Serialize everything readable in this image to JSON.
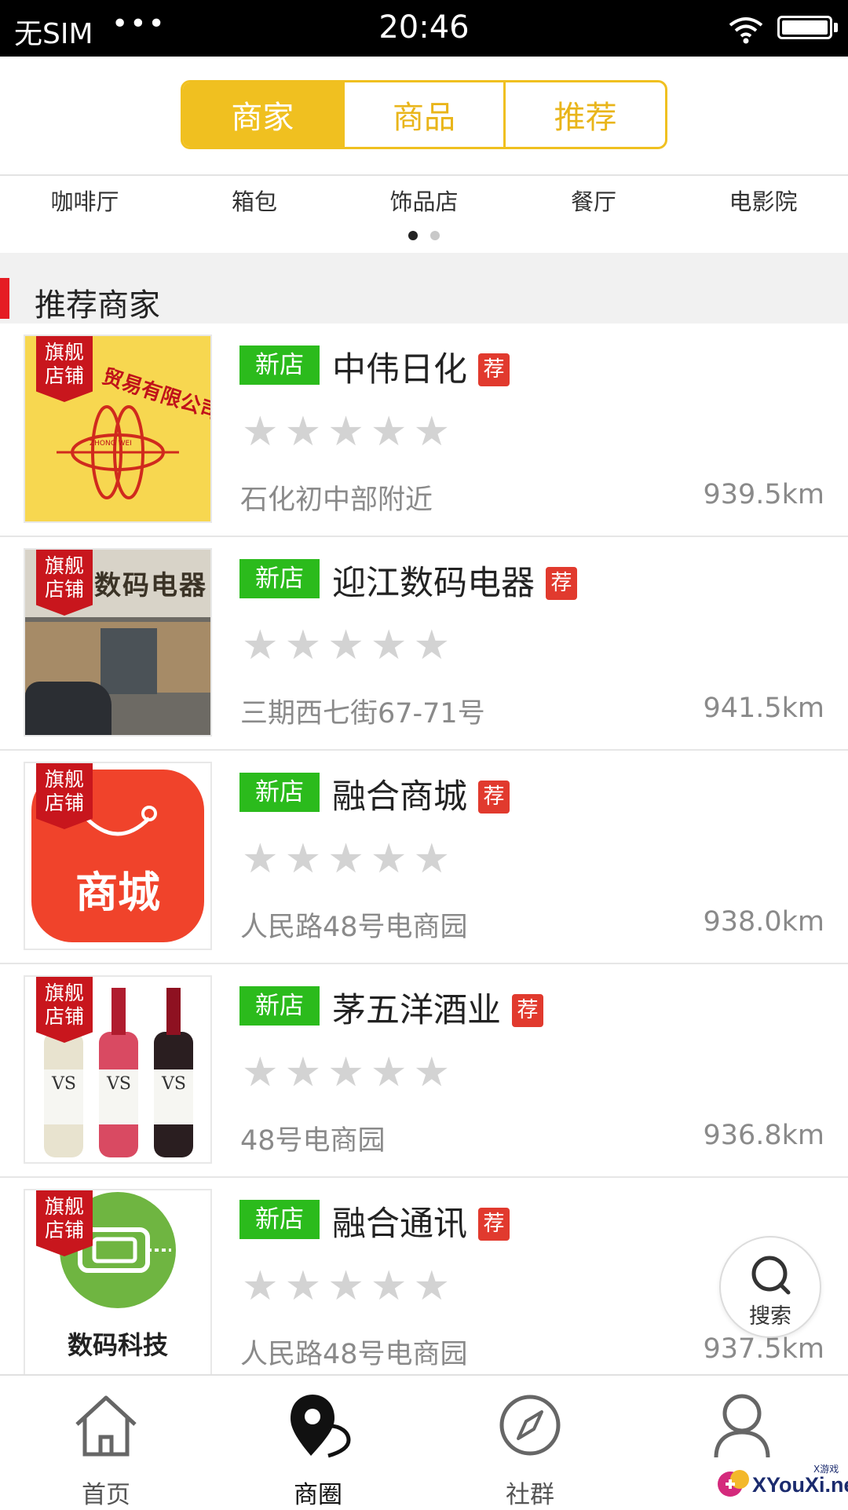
{
  "status_bar": {
    "carrier": "无SIM",
    "dots": "•••",
    "time": "20:46"
  },
  "segments": [
    {
      "label": "商家",
      "active": true
    },
    {
      "label": "商品",
      "active": false
    },
    {
      "label": "推荐",
      "active": false
    }
  ],
  "categories": [
    "咖啡厅",
    "箱包",
    "饰品店",
    "餐厅",
    "电影院"
  ],
  "carousel_page": {
    "current": 1,
    "total": 2
  },
  "section": {
    "title": "推荐商家"
  },
  "shops": [
    {
      "flag": "旗舰\n店铺",
      "badge": "新店",
      "name": "中伟日化",
      "rec": "荐",
      "rating": 0,
      "address": "石化初中部附近",
      "distance": "939.5km",
      "thumb_text": "贸易有限公司",
      "thumb_sub": "ZHONG WEI"
    },
    {
      "flag": "旗舰\n店铺",
      "badge": "新店",
      "name": "迎江数码电器",
      "rec": "荐",
      "rating": 0,
      "address": "三期西七街67-71号",
      "distance": "941.5km",
      "thumb_text": "数码电器"
    },
    {
      "flag": "旗舰\n店铺",
      "badge": "新店",
      "name": "融合商城",
      "rec": "荐",
      "rating": 0,
      "address": "人民路48号电商园",
      "distance": "938.0km",
      "thumb_text": "商城"
    },
    {
      "flag": "旗舰\n店铺",
      "badge": "新店",
      "name": "茅五洋酒业",
      "rec": "荐",
      "rating": 0,
      "address": "48号电商园",
      "distance": "936.8km",
      "thumb_text": "VS"
    },
    {
      "flag": "旗舰\n店铺",
      "badge": "新店",
      "name": "融合通讯",
      "rec": "荐",
      "rating": 0,
      "address": "人民路48号电商园",
      "distance": "937.5km",
      "thumb_text": "数码科技"
    }
  ],
  "search_button": {
    "label": "搜索"
  },
  "tabs": [
    {
      "label": "首页",
      "icon": "home-icon",
      "active": false
    },
    {
      "label": "商圈",
      "icon": "location-pin-icon",
      "active": true
    },
    {
      "label": "社群",
      "icon": "compass-icon",
      "active": false
    },
    {
      "label": "",
      "icon": "user-icon",
      "active": false
    }
  ],
  "watermark": {
    "text": "XYouXi.net",
    "small": "X游戏"
  },
  "colors": {
    "accent": "#f0c020",
    "new_badge": "#2bbb1c",
    "rec_badge": "#e13a2e",
    "flag": "#c8161d",
    "section_bar": "#e51c23"
  }
}
